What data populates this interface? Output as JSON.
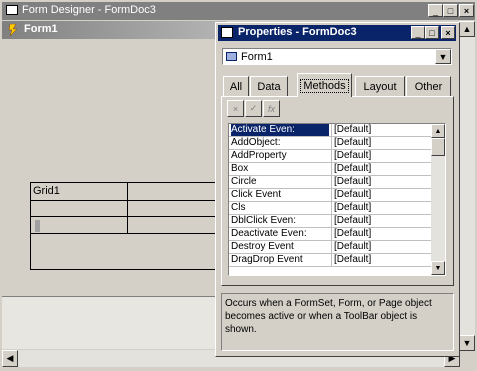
{
  "outer_window": {
    "title": "Form Designer - FormDoc3",
    "min_glyph": "_",
    "max_glyph": "□",
    "close_glyph": "×"
  },
  "form1": {
    "title": "Form1"
  },
  "grid": {
    "header": "Grid1"
  },
  "properties": {
    "title": "Properties - FormDoc3",
    "min_glyph": "_",
    "max_glyph": "□",
    "close_glyph": "×",
    "object_combo": "Form1",
    "tabs": [
      "All",
      "Data",
      "Methods",
      "Layout",
      "Other"
    ],
    "active_tab": "Methods",
    "tool_cancel": "×",
    "tool_accept": "✓",
    "tool_fx": "fx",
    "rows": [
      {
        "name": "Activate Even:",
        "value": "[Default]"
      },
      {
        "name": "AddObject:",
        "value": "[Default]"
      },
      {
        "name": "AddProperty",
        "value": "[Default]"
      },
      {
        "name": "Box",
        "value": "[Default]"
      },
      {
        "name": "Circle",
        "value": "[Default]"
      },
      {
        "name": "Click Event",
        "value": "[Default]"
      },
      {
        "name": "Cls",
        "value": "[Default]"
      },
      {
        "name": "DblClick Even:",
        "value": "[Default]"
      },
      {
        "name": "Deactivate Even:",
        "value": "[Default]"
      },
      {
        "name": "Destroy Event",
        "value": "[Default]"
      },
      {
        "name": "DragDrop Event",
        "value": "[Default]"
      }
    ],
    "description": "Occurs when a FormSet, Form, or Page object becomes active or when a ToolBar object is shown."
  },
  "colors": {
    "title_active": "#0a246a",
    "title_inactive": "#808080",
    "face": "#d4d0c8"
  }
}
